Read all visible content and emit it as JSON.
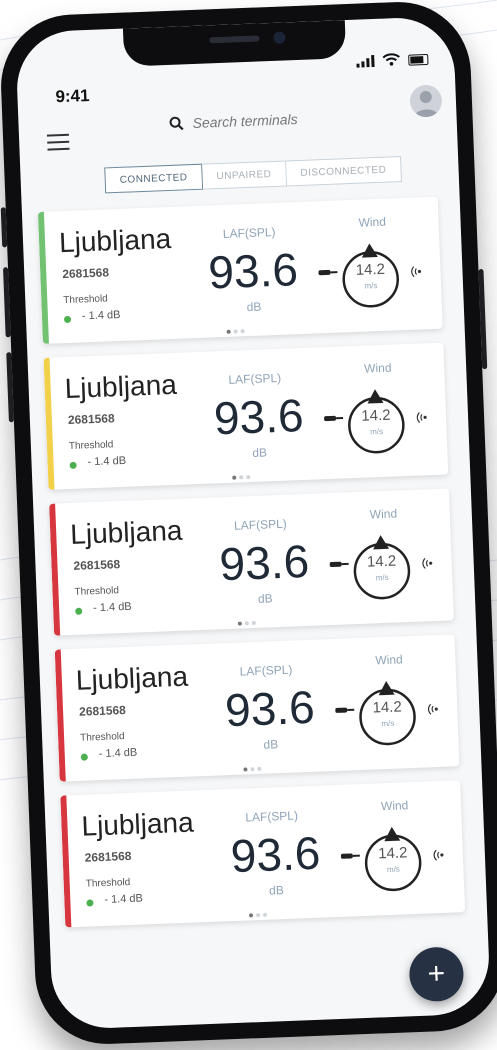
{
  "status": {
    "time": "9:41"
  },
  "search": {
    "placeholder": "Search terminals"
  },
  "tabs": [
    {
      "label": "CONNECTED",
      "active": true
    },
    {
      "label": "UNPAIRED",
      "active": false
    },
    {
      "label": "DISCONNECTED",
      "active": false
    }
  ],
  "terminals": [
    {
      "city": "Ljubljana",
      "id": "2681568",
      "threshold_label": "Threshold",
      "threshold_value": "- 1.4 dB",
      "metric_label": "LAF(SPL)",
      "value": "93.6",
      "unit": "dB",
      "wind_label": "Wind",
      "wind_value": "14.2",
      "wind_unit": "m/s",
      "status_color": "#72c272"
    },
    {
      "city": "Ljubljana",
      "id": "2681568",
      "threshold_label": "Threshold",
      "threshold_value": "- 1.4 dB",
      "metric_label": "LAF(SPL)",
      "value": "93.6",
      "unit": "dB",
      "wind_label": "Wind",
      "wind_value": "14.2",
      "wind_unit": "m/s",
      "status_color": "#f3d04a"
    },
    {
      "city": "Ljubljana",
      "id": "2681568",
      "threshold_label": "Threshold",
      "threshold_value": "- 1.4 dB",
      "metric_label": "LAF(SPL)",
      "value": "93.6",
      "unit": "dB",
      "wind_label": "Wind",
      "wind_value": "14.2",
      "wind_unit": "m/s",
      "status_color": "#d8363f"
    },
    {
      "city": "Ljubljana",
      "id": "2681568",
      "threshold_label": "Threshold",
      "threshold_value": "- 1.4 dB",
      "metric_label": "LAF(SPL)",
      "value": "93.6",
      "unit": "dB",
      "wind_label": "Wind",
      "wind_value": "14.2",
      "wind_unit": "m/s",
      "status_color": "#d8363f"
    },
    {
      "city": "Ljubljana",
      "id": "2681568",
      "threshold_label": "Threshold",
      "threshold_value": "- 1.4 dB",
      "metric_label": "LAF(SPL)",
      "value": "93.6",
      "unit": "dB",
      "wind_label": "Wind",
      "wind_value": "14.2",
      "wind_unit": "m/s",
      "status_color": "#d8363f"
    }
  ],
  "fab": {
    "label": "+"
  },
  "colors": {
    "accent": "#263244",
    "threshold_ok": "#4caf50",
    "muted": "#90a4b8"
  }
}
